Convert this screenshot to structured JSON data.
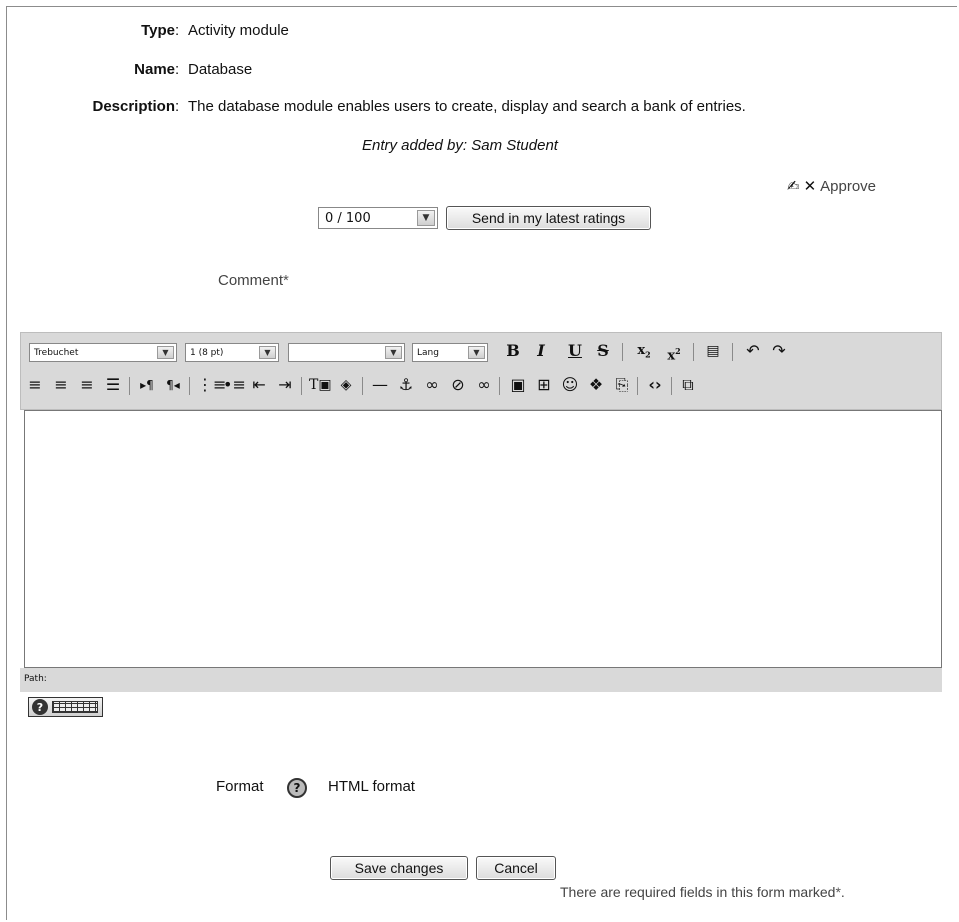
{
  "entry": {
    "type_label": "Type",
    "type_value": "Activity module",
    "name_label": "Name",
    "name_value": "Database",
    "description_label": "Description",
    "description_value": "The database module enables users to create, display and search a bank of entries.",
    "added_by": "Entry added by: Sam Student",
    "colon": ":"
  },
  "actions": {
    "approve_label": "Approve",
    "edit_icon": "✍",
    "delete_icon": "✕"
  },
  "rating": {
    "selected_value": "0 / 100",
    "send_button": "Send in my latest ratings"
  },
  "comment": {
    "label": "Comment",
    "required_mark": "*"
  },
  "editor": {
    "font_family": "Trebuchet",
    "font_size": "1 (8 pt)",
    "heading": "",
    "lang": "Lang",
    "path_label": "Path:"
  },
  "format": {
    "label": "Format",
    "value": "HTML format"
  },
  "buttons": {
    "save": "Save changes",
    "cancel": "Cancel"
  },
  "footer": {
    "required_note": "There are required fields in this form marked",
    "required_mark": "*",
    "period": "."
  }
}
